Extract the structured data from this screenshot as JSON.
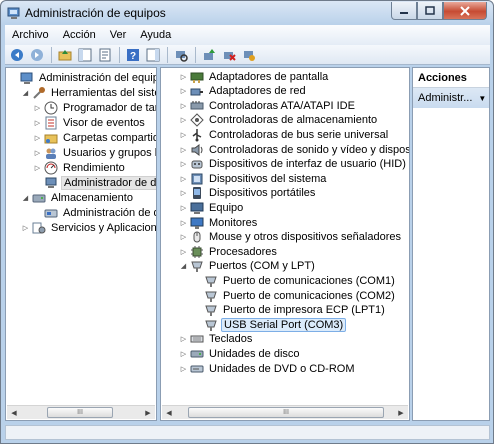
{
  "window": {
    "title": "Administración de equipos"
  },
  "menu": [
    "Archivo",
    "Acción",
    "Ver",
    "Ayuda"
  ],
  "toolbar_icons": [
    "back-icon",
    "forward-icon",
    "up-folder-icon",
    "show-hide-tree-icon",
    "properties-icon",
    "help-icon",
    "show-action-pane-icon",
    "scan-hardware-icon",
    "update-driver-icon",
    "uninstall-icon",
    "disable-icon"
  ],
  "left_tree": [
    {
      "label": "Administración del equipo (loc",
      "icon": "computer-management-icon",
      "arrow": "none",
      "indent": 0
    },
    {
      "label": "Herramientas del sistema",
      "icon": "tools-icon",
      "arrow": "expanded",
      "indent": 1
    },
    {
      "label": "Programador de tareas",
      "icon": "clock-icon",
      "arrow": "collapsed",
      "indent": 2
    },
    {
      "label": "Visor de eventos",
      "icon": "event-viewer-icon",
      "arrow": "collapsed",
      "indent": 2
    },
    {
      "label": "Carpetas compartidas",
      "icon": "shared-folder-icon",
      "arrow": "collapsed",
      "indent": 2
    },
    {
      "label": "Usuarios y grupos locale",
      "icon": "users-icon",
      "arrow": "collapsed",
      "indent": 2
    },
    {
      "label": "Rendimiento",
      "icon": "performance-icon",
      "arrow": "collapsed",
      "indent": 2
    },
    {
      "label": "Administrador de dispo",
      "icon": "device-manager-icon",
      "arrow": "none",
      "indent": 2,
      "selected": true
    },
    {
      "label": "Almacenamiento",
      "icon": "storage-icon",
      "arrow": "expanded",
      "indent": 1
    },
    {
      "label": "Administración de disco",
      "icon": "disk-management-icon",
      "arrow": "none",
      "indent": 2
    },
    {
      "label": "Servicios y Aplicaciones",
      "icon": "services-icon",
      "arrow": "collapsed",
      "indent": 1
    }
  ],
  "device_tree": [
    {
      "label": "Adaptadores de pantalla",
      "icon": "display-adapter-icon",
      "arrow": "collapsed",
      "indent": 0
    },
    {
      "label": "Adaptadores de red",
      "icon": "network-adapter-icon",
      "arrow": "collapsed",
      "indent": 0
    },
    {
      "label": "Controladoras ATA/ATAPI IDE",
      "icon": "ide-controller-icon",
      "arrow": "collapsed",
      "indent": 0
    },
    {
      "label": "Controladoras de almacenamiento",
      "icon": "storage-controller-icon",
      "arrow": "collapsed",
      "indent": 0
    },
    {
      "label": "Controladoras de bus serie universal",
      "icon": "usb-icon",
      "arrow": "collapsed",
      "indent": 0
    },
    {
      "label": "Controladoras de sonido y vídeo y dispositivos de",
      "icon": "sound-icon",
      "arrow": "collapsed",
      "indent": 0
    },
    {
      "label": "Dispositivos de interfaz de usuario (HID)",
      "icon": "hid-icon",
      "arrow": "collapsed",
      "indent": 0
    },
    {
      "label": "Dispositivos del sistema",
      "icon": "system-devices-icon",
      "arrow": "collapsed",
      "indent": 0
    },
    {
      "label": "Dispositivos portátiles",
      "icon": "portable-devices-icon",
      "arrow": "collapsed",
      "indent": 0
    },
    {
      "label": "Equipo",
      "icon": "computer-icon",
      "arrow": "collapsed",
      "indent": 0
    },
    {
      "label": "Monitores",
      "icon": "monitor-icon",
      "arrow": "collapsed",
      "indent": 0
    },
    {
      "label": "Mouse y otros dispositivos señaladores",
      "icon": "mouse-icon",
      "arrow": "collapsed",
      "indent": 0
    },
    {
      "label": "Procesadores",
      "icon": "processor-icon",
      "arrow": "collapsed",
      "indent": 0
    },
    {
      "label": "Puertos (COM y LPT)",
      "icon": "port-icon",
      "arrow": "expanded",
      "indent": 0
    },
    {
      "label": "Puerto de comunicaciones (COM1)",
      "icon": "port-icon",
      "arrow": "none",
      "indent": 1
    },
    {
      "label": "Puerto de comunicaciones (COM2)",
      "icon": "port-icon",
      "arrow": "none",
      "indent": 1
    },
    {
      "label": "Puerto de impresora ECP (LPT1)",
      "icon": "port-icon",
      "arrow": "none",
      "indent": 1
    },
    {
      "label": "USB Serial Port (COM3)",
      "icon": "port-icon",
      "arrow": "none",
      "indent": 1,
      "selected": true
    },
    {
      "label": "Teclados",
      "icon": "keyboard-icon",
      "arrow": "collapsed",
      "indent": 0
    },
    {
      "label": "Unidades de disco",
      "icon": "disk-drive-icon",
      "arrow": "collapsed",
      "indent": 0
    },
    {
      "label": "Unidades de DVD o CD-ROM",
      "icon": "dvd-icon",
      "arrow": "collapsed",
      "indent": 0
    }
  ],
  "actions": {
    "header": "Acciones",
    "item": "Administr..."
  },
  "scrollbar": {
    "thumb_grip": "III"
  },
  "colors": {
    "selection_blue": "#dbebfb",
    "selection_border": "#7daee6",
    "chrome": "#b9d1ea"
  }
}
